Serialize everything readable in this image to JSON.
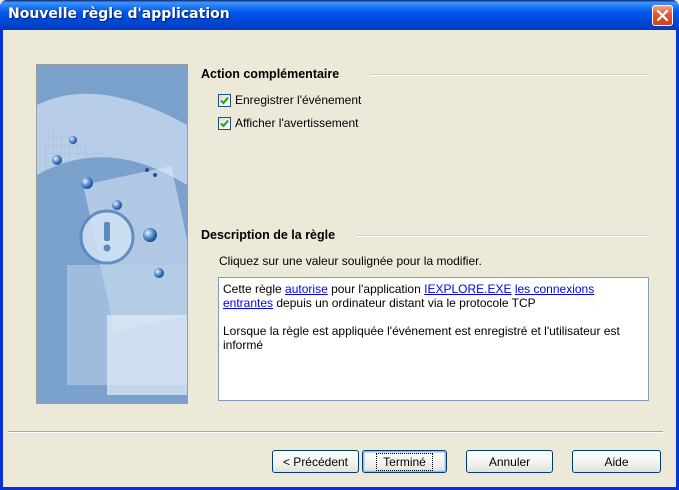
{
  "window": {
    "title": "Nouvelle règle d'application"
  },
  "action": {
    "header": "Action complémentaire",
    "checkboxes": [
      {
        "label": "Enregistrer l'événement",
        "checked": true
      },
      {
        "label": "Afficher l'avertissement",
        "checked": true
      }
    ]
  },
  "description": {
    "header": "Description de la règle",
    "hint": "Cliquez sur une valeur soulignée pour la modifier.",
    "line1_prefix": "Cette règle ",
    "link_allow": "autorise",
    "line1_mid": " pour l'application ",
    "link_app": "IEXPLORE.EXE",
    "link_conn": "les connexions entrantes",
    "line1_suffix": " depuis un ordinateur distant via le protocole TCP",
    "line2": "Lorsque la règle est appliquée l'événement est enregistré et l'utilisateur est informé"
  },
  "buttons": {
    "back": "< Précédent",
    "finish": "Terminé",
    "cancel": "Annuler",
    "help": "Aide"
  },
  "colors": {
    "titlebar": "#0058ee",
    "close": "#e3572e",
    "link": "#0000ff",
    "checkmark": "#21a121"
  },
  "icons": {
    "close": "close-icon",
    "check": "checkmark-icon",
    "wizard": "warning-icon"
  }
}
